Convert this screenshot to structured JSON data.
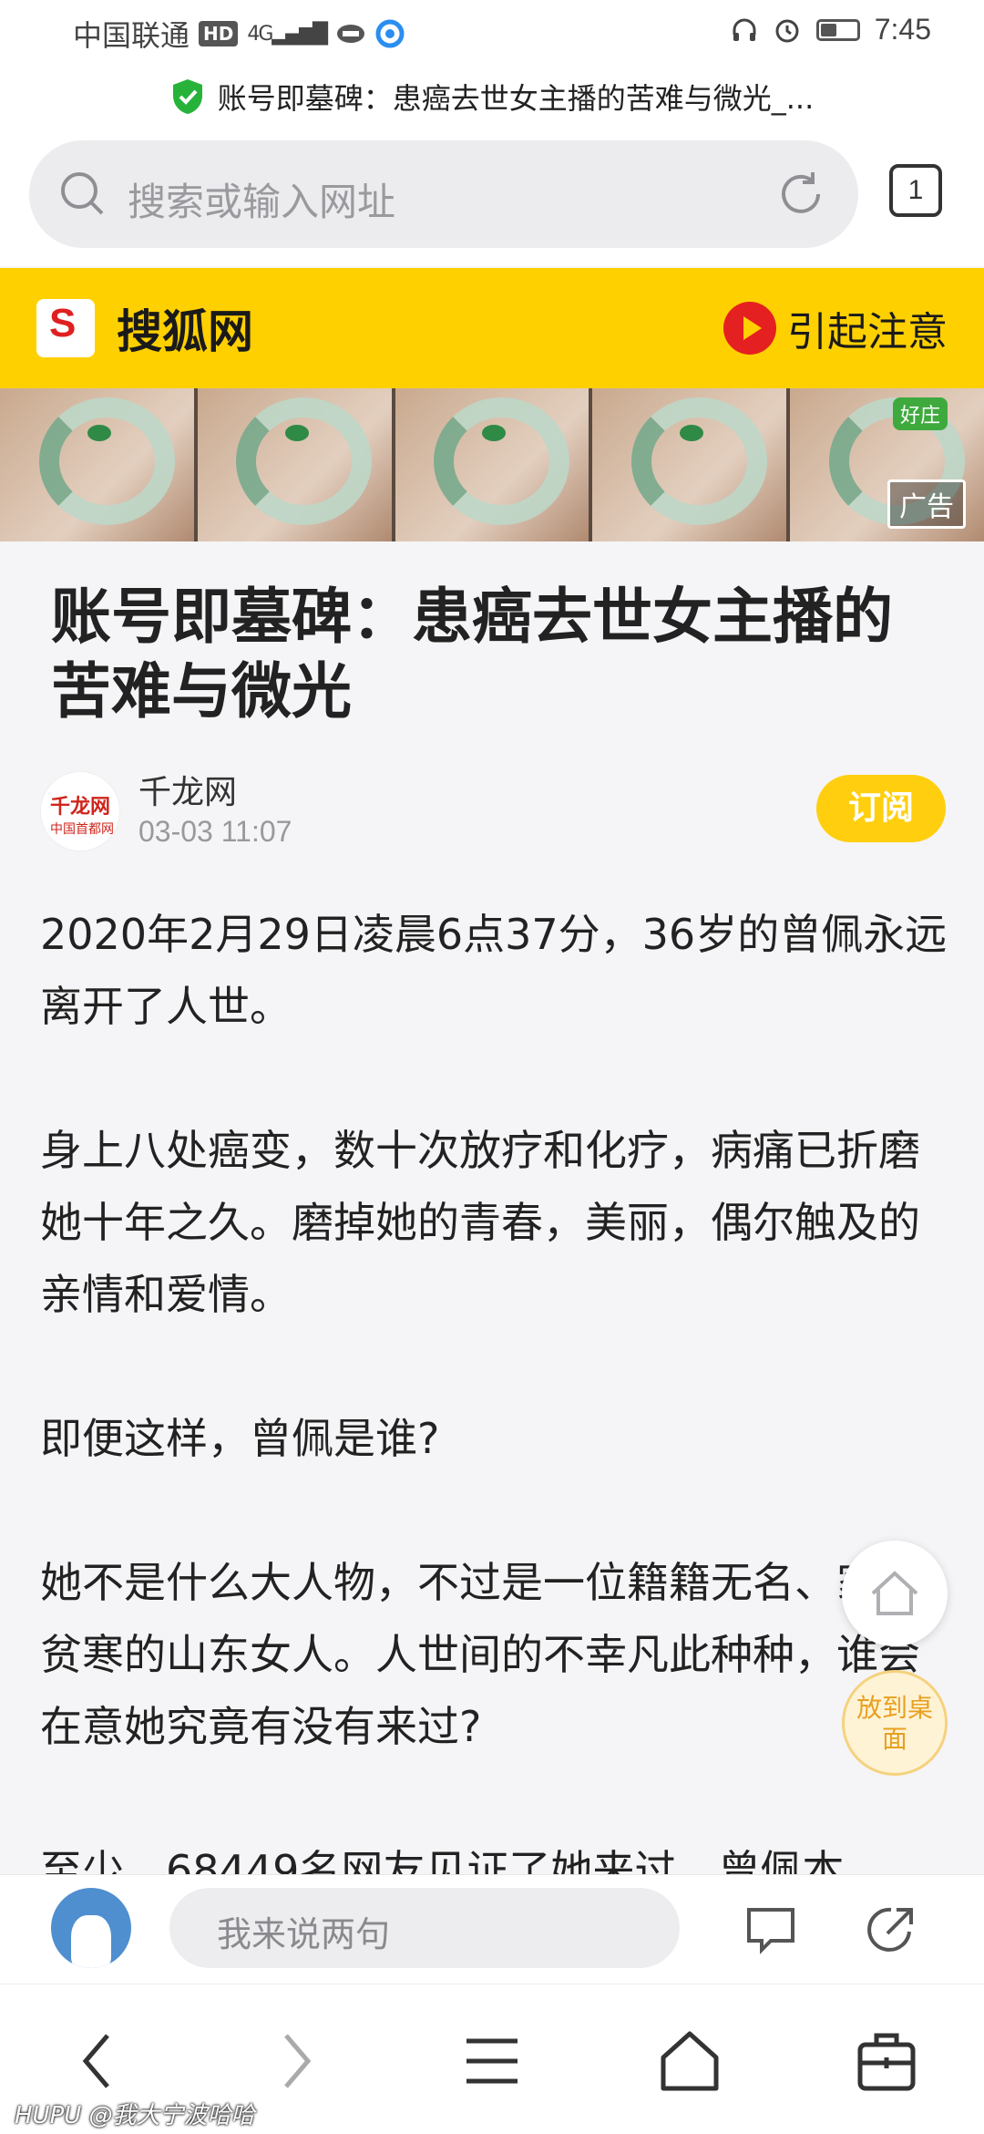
{
  "status_bar": {
    "carrier": "中国联通",
    "network": "HD",
    "signal": "4G",
    "time": "7:45"
  },
  "page_title": "账号即墓碑：患癌去世女主播的苦难与微光_...",
  "search": {
    "placeholder": "搜索或输入网址",
    "tab_count": "1"
  },
  "site_header": {
    "logo_letter": "S",
    "site_name": "搜狐网",
    "attention_label": "引起注意"
  },
  "ad": {
    "label": "广告",
    "corner_tag": "好庄"
  },
  "article": {
    "headline": "账号即墓碑：患癌去世女主播的苦难与微光",
    "source": {
      "logo_text": "千龙网",
      "logo_sub": "中国首都网",
      "name": "千龙网",
      "time": "03-03 11:07"
    },
    "subscribe_label": "订阅",
    "paragraphs": [
      "2020年2月29日凌晨6点37分，36岁的曾佩永远离开了人世。",
      "身上八处癌变，数十次放疗和化疗，病痛已折磨她十年之久。磨掉她的青春，美丽，偶尔触及的亲情和爱情。",
      "即便这样，曾佩是谁?",
      "她不是什么大人物，不过是一位籍籍无名、家境贫寒的山东女人。人世间的不幸凡此种种，谁会在意她究竟有没有来过?",
      "至少，68449名网友见证了她来过。曾佩本"
    ]
  },
  "floating": {
    "desktop_label": "放到桌面"
  },
  "comment_bar": {
    "placeholder": "我来说两句"
  },
  "watermark": "HUPU @我大宁波哈哈"
}
